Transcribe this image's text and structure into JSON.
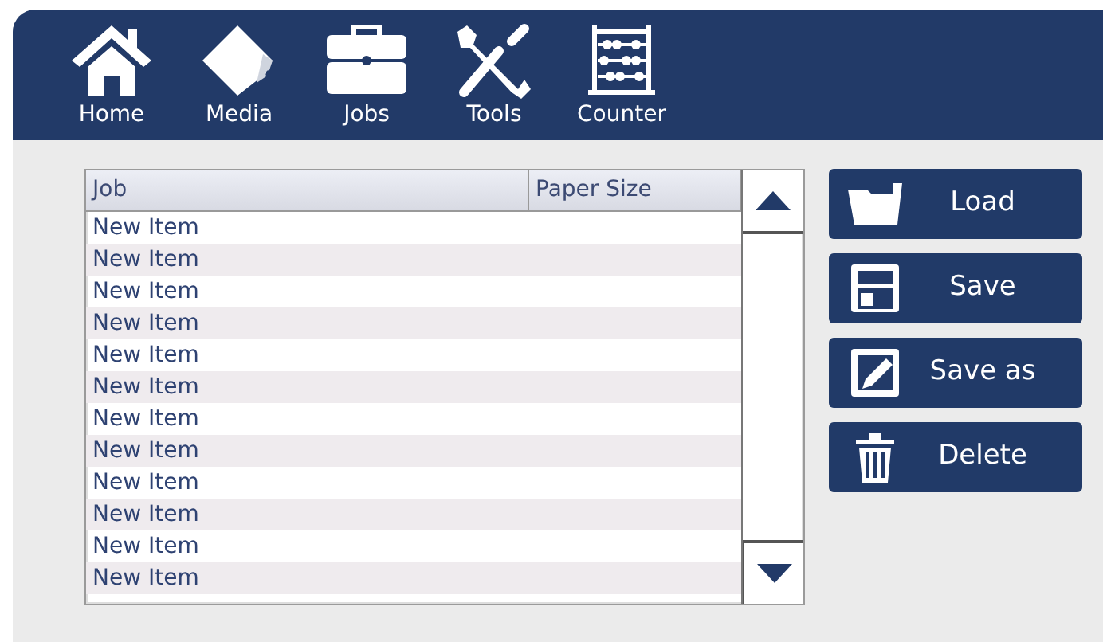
{
  "nav": [
    {
      "label": "Home"
    },
    {
      "label": "Media"
    },
    {
      "label": "Jobs"
    },
    {
      "label": "Tools"
    },
    {
      "label": "Counter"
    }
  ],
  "table": {
    "columns": [
      "Job",
      "Paper Size"
    ],
    "rows": [
      {
        "job": "New Item"
      },
      {
        "job": "New Item"
      },
      {
        "job": "New Item"
      },
      {
        "job": "New Item"
      },
      {
        "job": "New Item"
      },
      {
        "job": "New Item"
      },
      {
        "job": "New Item"
      },
      {
        "job": "New Item"
      },
      {
        "job": "New Item"
      },
      {
        "job": "New Item"
      },
      {
        "job": "New Item"
      },
      {
        "job": "New Item"
      }
    ]
  },
  "actions": [
    {
      "label": "Load"
    },
    {
      "label": "Save"
    },
    {
      "label": "Save as"
    },
    {
      "label": "Delete"
    }
  ]
}
